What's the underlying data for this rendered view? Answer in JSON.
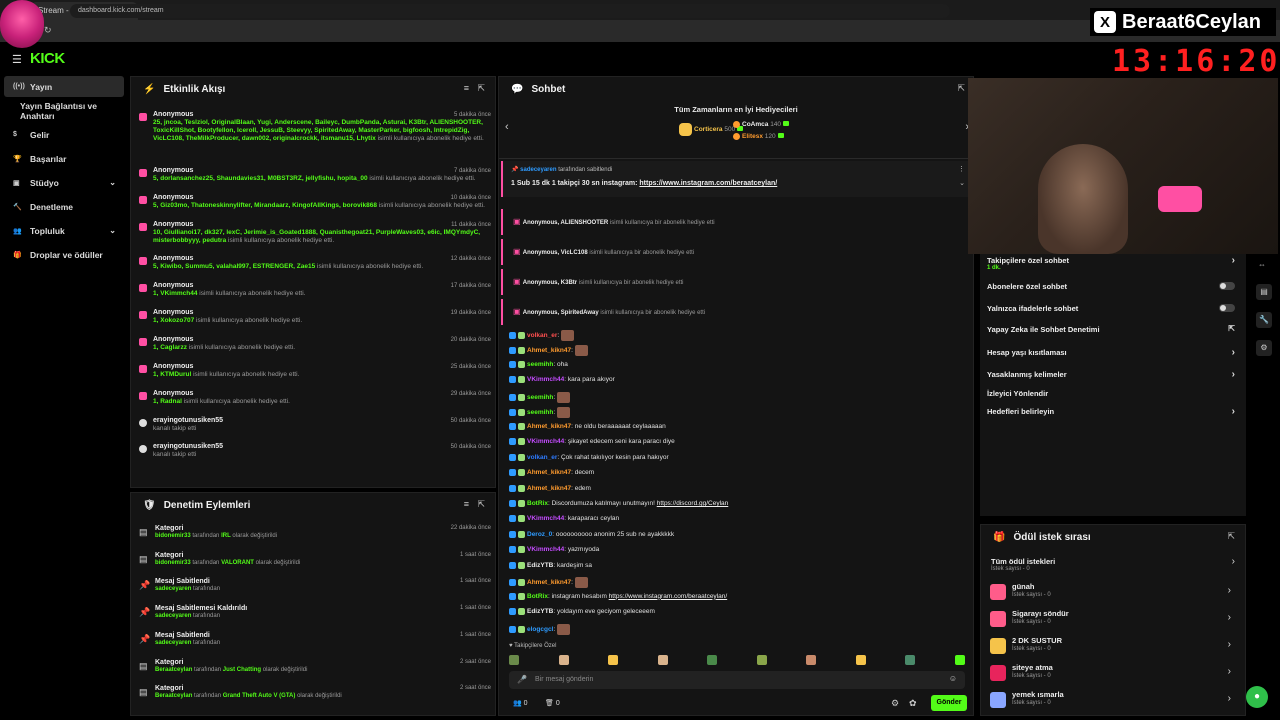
{
  "browser": {
    "tab_title": "Stream - Kick Dashboard",
    "url": "dashboard.kick.com/stream"
  },
  "overlay": {
    "streamer": "Beraat6Ceylan",
    "clock": "13:16:20"
  },
  "brand": {
    "logo": "KICK",
    "accent": "#53fc18"
  },
  "sidebar": {
    "items": [
      {
        "label": "Yayın",
        "icon": "broadcast-icon"
      },
      {
        "label": "Yayın Bağlantısı ve Anahtarı",
        "icon": ""
      },
      {
        "label": "Gelir",
        "icon": "dollar-icon"
      },
      {
        "label": "Başarılar",
        "icon": "trophy-icon"
      },
      {
        "label": "Stüdyo",
        "icon": "studio-icon"
      },
      {
        "label": "Denetleme",
        "icon": "hammer-icon"
      },
      {
        "label": "Topluluk",
        "icon": "community-icon"
      },
      {
        "label": "Droplar ve ödüller",
        "icon": "gift-icon"
      }
    ]
  },
  "activity": {
    "title": "Etkinlik Akışı",
    "items": [
      {
        "name": "Anonymous",
        "time": "5 dakika önce",
        "count": "25,",
        "users": "jncoa, Teslziol, OriginalBlaan, Yugi, Anderscene, Baileyc, DumbPanda, Asturai, K3Btr, ALIENSHOOTER, ToxicKillShot, Bootyfellon, Iceroll, JessuB, Steevyy, SpiritedAway, MasterParker, bigfoosh, IntrepidZig, VicLC108, TheMilkProducer, dawn002, originalcrockk, itsmanu15, Lhytix",
        "desc": "isimli kullanıcıya abonelik hediye etti."
      },
      {
        "name": "Anonymous",
        "time": "7 dakika önce",
        "count": "5,",
        "users": "dorlansanchez25, Shaundavies31, M0BST3RZ, jellyfishu, hopita_00",
        "desc": "isimli kullanıcıya abonelik hediye etti."
      },
      {
        "name": "Anonymous",
        "time": "10 dakika önce",
        "count": "5,",
        "users": "Giz03mo, Thatoneskinnylifter, Mirandaarz, KingofAllKings, borovik868",
        "desc": "isimli kullanıcıya abonelik hediye etti."
      },
      {
        "name": "Anonymous",
        "time": "11 dakika önce",
        "count": "10,",
        "users": "Giullianoi17, dk327, lexC, Jerimie_is_Goated1888, Quanisthegoat21, PurpleWaves03, e6ic, IMQYmdyC, misterbobbyyy, pedutra",
        "desc": "isimli kullanıcıya abonelik hediye etti."
      },
      {
        "name": "Anonymous",
        "time": "12 dakika önce",
        "count": "5,",
        "users": "Kiwibo, Summu5, valahal997, ESTRENGER, Zae15",
        "desc": "isimli kullanıcıya abonelik hediye etti."
      },
      {
        "name": "Anonymous",
        "time": "17 dakika önce",
        "count": "1,",
        "users": "VKimmch44",
        "desc": "isimli kullanıcıya abonelik hediye etti."
      },
      {
        "name": "Anonymous",
        "time": "19 dakika önce",
        "count": "1,",
        "users": "Xokozo707",
        "desc": "isimli kullanıcıya abonelik hediye etti."
      },
      {
        "name": "Anonymous",
        "time": "20 dakika önce",
        "count": "1,",
        "users": "Caglarzz",
        "desc": "isimli kullanıcıya abonelik hediye etti."
      },
      {
        "name": "Anonymous",
        "time": "25 dakika önce",
        "count": "1,",
        "users": "KTMDurul",
        "desc": "isimli kullanıcıya abonelik hediye etti."
      },
      {
        "name": "Anonymous",
        "time": "29 dakika önce",
        "count": "1,",
        "users": "Radnal",
        "desc": "isimli kullanıcıya abonelik hediye etti."
      },
      {
        "name": "erayingotunusiken55",
        "time": "50 dakika önce",
        "count": "",
        "users": "",
        "desc": "kanalı takip etti"
      },
      {
        "name": "erayingotunusiken55",
        "time": "50 dakika önce",
        "count": "",
        "users": "",
        "desc": "kanalı takip etti"
      }
    ]
  },
  "moderation": {
    "title": "Denetim Eylemleri",
    "items": [
      {
        "title": "Kategori",
        "user": "bidonemir33",
        "mid": "tarafından",
        "value": "IRL",
        "suffix": "olarak değiştirildi",
        "time": "22 dakika önce"
      },
      {
        "title": "Kategori",
        "user": "bidonemir33",
        "mid": "tarafından",
        "value": "VALORANT",
        "suffix": "olarak değiştirildi",
        "time": "1 saat önce"
      },
      {
        "title": "Mesaj Sabitlendi",
        "user": "sadeceyaren",
        "mid": "tarafından",
        "value": "",
        "suffix": "",
        "time": "1 saat önce"
      },
      {
        "title": "Mesaj Sabitlemesi Kaldırıldı",
        "user": "sadeceyaren",
        "mid": "tarafından",
        "value": "",
        "suffix": "",
        "time": "1 saat önce"
      },
      {
        "title": "Mesaj Sabitlendi",
        "user": "sadeceyaren",
        "mid": "tarafından",
        "value": "",
        "suffix": "",
        "time": "1 saat önce"
      },
      {
        "title": "Kategori",
        "user": "Beraatceylan",
        "mid": "tarafından",
        "value": "Just Chatting",
        "suffix": "olarak değiştirildi",
        "time": "2 saat önce"
      },
      {
        "title": "Kategori",
        "user": "Beraatceylan",
        "mid": "tarafından",
        "value": "Grand Theft Auto V (GTA)",
        "suffix": "olarak değiştirildi",
        "time": "2 saat önce"
      }
    ]
  },
  "chat": {
    "title": "Sohbet",
    "leaderboard_title": "Tüm Zamanların en İyi Hediyecileri",
    "leaders": [
      {
        "rank": "1",
        "name": "Corticera",
        "value": "500"
      },
      {
        "rank": "2",
        "name": "CoAmca",
        "value": "140"
      },
      {
        "rank": "3",
        "name": "Elitesx",
        "value": "120"
      }
    ],
    "pinned_by": "sadeceyaren",
    "pinned_by_suffix": "tarafından sabitlendi",
    "pinned_text": "1 Sub 15 dk 1 takipçi 30 sn instagram:",
    "pinned_link": "https://www.instagram.com/beraatceylan/",
    "gift_events": [
      {
        "user": "Anonymous, ALIENSHOOTER",
        "text": "isimli kullanıcıya bir abonelik hediye etti"
      },
      {
        "user": "Anonymous, VicLC108",
        "text": "isimli kullanıcıya bir abonelik hediye etti"
      },
      {
        "user": "Anonymous, K3Btr",
        "text": "isimli kullanıcıya bir abonelik hediye etti"
      },
      {
        "user": "Anonymous, SpiritedAway",
        "text": "isimli kullanıcıya bir abonelik hediye etti"
      }
    ],
    "messages": [
      {
        "user": "volkan_er",
        "color": "#ff4f4f",
        "text": "",
        "emote": true
      },
      {
        "user": "Ahmet_kikn47",
        "color": "#ff9b2e",
        "text": "",
        "emote": true
      },
      {
        "user": "seemihh",
        "color": "#53fc18",
        "text": "oha",
        "emote": false
      },
      {
        "user": "VKimmch44",
        "color": "#c44cff",
        "text": "kara para akıyor",
        "emote": false
      },
      {
        "user": "seemihh",
        "color": "#53fc18",
        "text": "",
        "emote": true
      },
      {
        "user": "seemihh",
        "color": "#53fc18",
        "text": "",
        "emote": true
      },
      {
        "user": "Ahmet_kikn47",
        "color": "#ff9b2e",
        "text": "ne oldu beraaaaaat ceylaaaaan",
        "emote": false
      },
      {
        "user": "VKimmch44",
        "color": "#c44cff",
        "text": "şikayet edecem seni kara paracı diye",
        "emote": false
      },
      {
        "user": "volkan_er",
        "color": "#2e7bff",
        "text": "Çok rahat takılıyor kesin para hakıyor",
        "emote": false
      },
      {
        "user": "Ahmet_kikn47",
        "color": "#ff9b2e",
        "text": "decem",
        "emote": false
      },
      {
        "user": "Ahmet_kikn47",
        "color": "#ff9b2e",
        "text": "edem",
        "emote": false
      },
      {
        "user": "BotRix",
        "color": "#53fc18",
        "text": "Discordumuza katılmayı unutmayın!",
        "link": "https://discord.gg/Ceylan",
        "emote": false
      },
      {
        "user": "VKimmch44",
        "color": "#c44cff",
        "text": "karaparacı ceylan",
        "emote": false
      },
      {
        "user": "Deroz_0",
        "color": "#2e9bff",
        "text": "oooooooooo anonim 25 sub ne ayakkkkk",
        "emote": false
      },
      {
        "user": "VKimmch44",
        "color": "#c44cff",
        "text": "yazmıyoda",
        "emote": false
      },
      {
        "user": "EdizYTB",
        "color": "#e8e8e8",
        "text": "kardeşim sa",
        "emote": false
      },
      {
        "user": "Ahmet_kikn47",
        "color": "#ff9b2e",
        "text": "",
        "emote": true
      },
      {
        "user": "BotRix",
        "color": "#53fc18",
        "text": "instagram hesabım",
        "link": "https://www.instagram.com/beraatceylan/",
        "emote": false
      },
      {
        "user": "EdizYTB",
        "color": "#e8e8e8",
        "text": "yoldayım eve geciyom geleceeem",
        "emote": false
      },
      {
        "user": "elogcgcl",
        "color": "#2e9bff",
        "text": "",
        "emote": true
      }
    ],
    "followers_only": "Takipçilere Özel",
    "input_placeholder": "Bir mesaj gönderin",
    "viewers": "0",
    "bags": "0",
    "send_label": "Gönder"
  },
  "settings": {
    "items": [
      {
        "label": "Takipçilere özel sohbet",
        "sub": "1 dk.",
        "control": "chevron"
      },
      {
        "label": "Abonelere özel sohbet",
        "sub": "",
        "control": "toggle"
      },
      {
        "label": "Yalnızca ifadelerle sohbet",
        "sub": "",
        "control": "toggle"
      },
      {
        "label": "Yapay Zeka ile Sohbet Denetimi",
        "sub": "",
        "control": "external"
      },
      {
        "label": "Hesap yaşı kısıtlaması",
        "sub": "",
        "control": "chevron"
      },
      {
        "label": "Yasaklanmış kelimeler",
        "sub": "",
        "control": "chevron"
      },
      {
        "label": "İzleyici Yönlendir",
        "sub": "",
        "control": "none"
      },
      {
        "label": "Hedefleri belirleyin",
        "sub": "",
        "control": "chevron"
      }
    ]
  },
  "rewards": {
    "title": "Ödül istek sırası",
    "all_label": "Tüm ödül istekleri",
    "all_sub": "İstek sayısı - 0",
    "items": [
      {
        "label": "günah",
        "sub": "İstek sayısı - 0",
        "color": "#ff5c8a"
      },
      {
        "label": "Sigarayı söndür",
        "sub": "İstek sayısı - 0",
        "color": "#ff5c8a"
      },
      {
        "label": "2 DK SUSTUR",
        "sub": "İstek sayısı - 0",
        "color": "#f5c34a"
      },
      {
        "label": "siteye atma",
        "sub": "İstek sayısı - 0",
        "color": "#e8245c"
      },
      {
        "label": "yemek ısmarla",
        "sub": "İstek sayısı - 0",
        "color": "#8aa6ff"
      }
    ]
  }
}
